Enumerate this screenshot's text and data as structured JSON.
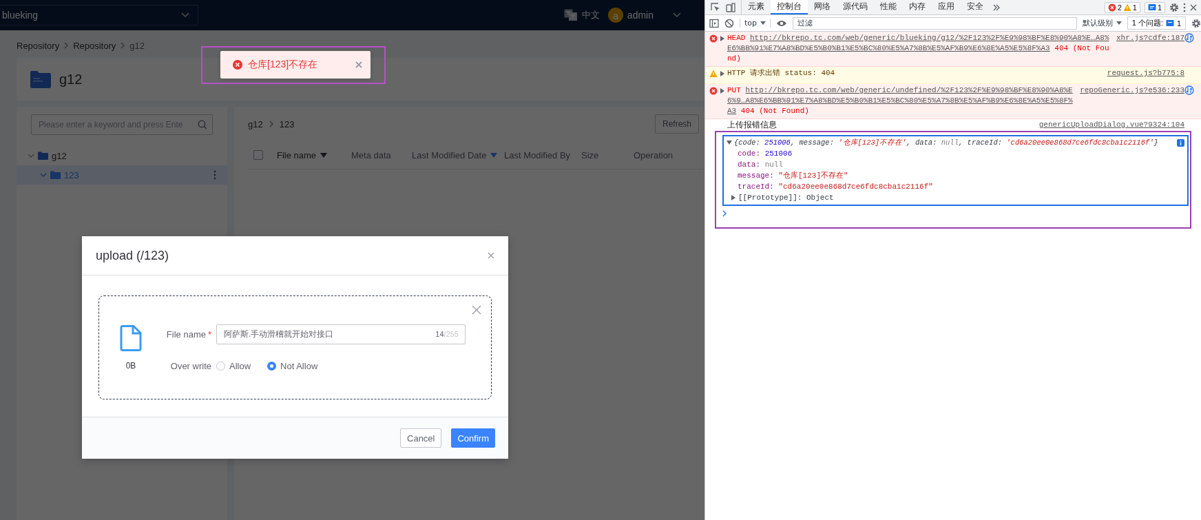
{
  "app": {
    "project_select": "blueking",
    "language": "中文",
    "user": {
      "avatar_letter": "a",
      "name": "admin"
    },
    "breadcrumb": [
      "Repository",
      "Repository",
      "g12"
    ],
    "repo_title": "g12",
    "search": {
      "placeholder": "Please enter a keyword and press Ente"
    },
    "tree": [
      {
        "label": "g12",
        "expanded": true,
        "selected": false,
        "children": [
          {
            "label": "123",
            "expanded": true,
            "selected": true
          }
        ]
      }
    ],
    "path": [
      "g12",
      "123"
    ],
    "refresh_button": "Refresh",
    "table": {
      "select_all": {
        "checked": false
      },
      "columns": [
        {
          "label": "File name",
          "sortable": true,
          "sorted": false
        },
        {
          "label": "Meta data",
          "sortable": false
        },
        {
          "label": "Last Modified Date",
          "sortable": true,
          "sorted": true
        },
        {
          "label": "Last Modified By",
          "sortable": false
        },
        {
          "label": "Size",
          "sortable": false
        },
        {
          "label": "Operation",
          "sortable": false
        }
      ]
    }
  },
  "toast": {
    "kind": "error",
    "message": "仓库[123]不存在"
  },
  "dialog": {
    "title": "upload (/123)",
    "file_size": "0B",
    "file_name_label": "File name",
    "required_mark": "*",
    "file_name_value": "阿萨斯.手动滑稽就开始对接口",
    "count": "14",
    "limit": "/255",
    "overwrite_label": "Over write",
    "options": [
      {
        "label": "Allow",
        "selected": false
      },
      {
        "label": "Not Allow",
        "selected": true
      }
    ],
    "buttons": [
      {
        "label": "Cancel",
        "kind": "secondary"
      },
      {
        "label": "Confirm",
        "kind": "primary"
      }
    ]
  },
  "devtools": {
    "tabs": [
      {
        "label": "元素",
        "selected": false
      },
      {
        "label": "控制台",
        "selected": true
      },
      {
        "label": "网络",
        "selected": false
      },
      {
        "label": "源代码",
        "selected": false
      },
      {
        "label": "性能",
        "selected": false
      },
      {
        "label": "内存",
        "selected": false
      },
      {
        "label": "应用",
        "selected": false
      },
      {
        "label": "安全",
        "selected": false
      }
    ],
    "error_count": "2",
    "warning_count": "1",
    "message_count": "1",
    "context": "top",
    "filter": {
      "placeholder": "过滤"
    },
    "level": "默认级别",
    "issues_label": "1 个问题:",
    "issues_count": "1",
    "messages": [
      {
        "kind": "error",
        "method": "HEAD",
        "url": "http://bkrepo.tc.com/web/generic/blueking/g12/%2F123%2F%E9%98%BF%E8%90%A8%E…A8%E6%BB%91%E7%A8%BD%E5%B0%B1%E5%BC%80%E5%A7%8B%E5%AF%B9%E6%8E%A5%E5%8F%A3",
        "status": "404 (Not Found)",
        "source": "xhr.js?cdfe:187"
      },
      {
        "kind": "warning",
        "text": "HTTP 请求出错 status: 404",
        "source": "request.js?b775:8"
      },
      {
        "kind": "error",
        "method": "PUT",
        "url": "http://bkrepo.tc.com/web/generic/undefined/%2F123%2F%E9%98%BF%E8%90%A8%E6%9…A8%E6%BB%91%E7%A8%BD%E5%B0%B1%E5%BC%80%E5%A7%8B%E5%AF%B9%E6%8E%A5%E5%8F%A3",
        "status": "404 (Not Found)",
        "source": "repoGeneric.js?e536:233"
      },
      {
        "kind": "log",
        "text": "上传报错信息",
        "source": "genericUploadDialog.vue?9324:104",
        "object": {
          "expanded": true,
          "summary": [
            {
              "text": "{code: ",
              "kind": "plain"
            },
            {
              "text": "251006",
              "kind": "number"
            },
            {
              "text": ", message: ",
              "kind": "plain"
            },
            {
              "text": "'仓库[123]不存在'",
              "kind": "string"
            },
            {
              "text": ", data: ",
              "kind": "plain"
            },
            {
              "text": "null",
              "kind": "null"
            },
            {
              "text": ", traceId: ",
              "kind": "plain"
            },
            {
              "text": "'cd6a20ee0e868d7ce6fdc8cba1c2116f'",
              "kind": "string"
            },
            {
              "text": "}",
              "kind": "plain"
            }
          ],
          "properties": [
            {
              "key": "code:",
              "value": "251006",
              "kind": "number"
            },
            {
              "key": "data:",
              "value": "null",
              "kind": "null"
            },
            {
              "key": "message:",
              "value": "\"仓库[123]不存在\"",
              "kind": "string"
            },
            {
              "key": "traceId:",
              "value": "\"cd6a20ee0e868d7ce6fdc8cba1c2116f\"",
              "kind": "string"
            }
          ],
          "prototype": {
            "text": "[[Prototype]]: Object",
            "expanded": false
          }
        }
      }
    ]
  }
}
